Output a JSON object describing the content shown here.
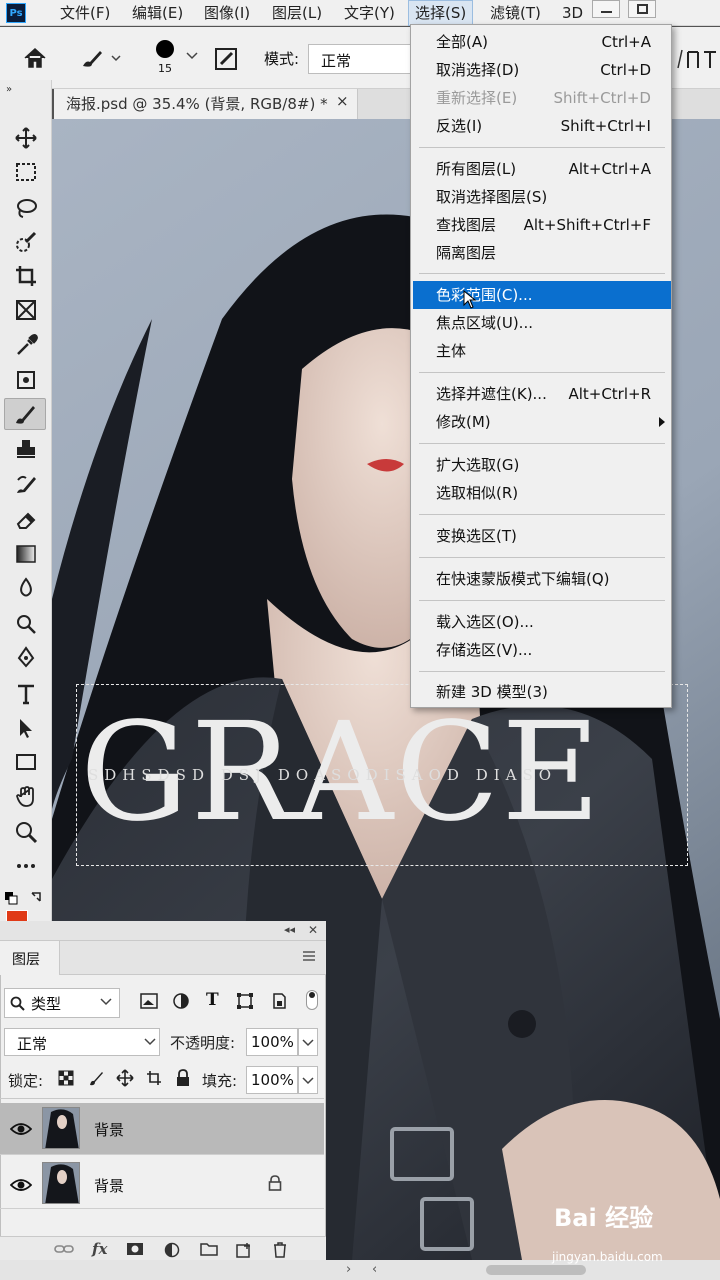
{
  "app": {
    "logo": "Ps"
  },
  "menubar": {
    "items": [
      "文件(F)",
      "编辑(E)",
      "图像(I)",
      "图层(L)",
      "文字(Y)",
      "选择(S)",
      "滤镜(T)",
      "3D"
    ]
  },
  "options": {
    "brush_size": "15",
    "mode_label": "模式:",
    "mode_value": "正常"
  },
  "document": {
    "tab_title": "海报.psd @ 35.4% (背景, RGB/8#) *",
    "close_glyph": "×"
  },
  "canvas": {
    "big_text": "GRACE",
    "small_text": "SDHSDSD DSJ DOASODISAOD DIASO"
  },
  "select_menu": {
    "groups": [
      [
        {
          "label": "全部(A)",
          "shortcut": "Ctrl+A",
          "disabled": false
        },
        {
          "label": "取消选择(D)",
          "shortcut": "Ctrl+D",
          "disabled": false
        },
        {
          "label": "重新选择(E)",
          "shortcut": "Shift+Ctrl+D",
          "disabled": true
        },
        {
          "label": "反选(I)",
          "shortcut": "Shift+Ctrl+I",
          "disabled": false
        }
      ],
      [
        {
          "label": "所有图层(L)",
          "shortcut": "Alt+Ctrl+A",
          "disabled": false
        },
        {
          "label": "取消选择图层(S)",
          "shortcut": "",
          "disabled": false
        },
        {
          "label": "查找图层",
          "shortcut": "Alt+Shift+Ctrl+F",
          "disabled": false
        },
        {
          "label": "隔离图层",
          "shortcut": "",
          "disabled": false
        }
      ],
      [
        {
          "label": "色彩范围(C)...",
          "shortcut": "",
          "disabled": false,
          "highlighted": true
        },
        {
          "label": "焦点区域(U)...",
          "shortcut": "",
          "disabled": false
        },
        {
          "label": "主体",
          "shortcut": "",
          "disabled": false
        }
      ],
      [
        {
          "label": "选择并遮住(K)...",
          "shortcut": "Alt+Ctrl+R",
          "disabled": false
        },
        {
          "label": "修改(M)",
          "shortcut": "",
          "disabled": false,
          "submenu": true
        }
      ],
      [
        {
          "label": "扩大选取(G)",
          "shortcut": "",
          "disabled": false
        },
        {
          "label": "选取相似(R)",
          "shortcut": "",
          "disabled": false
        }
      ],
      [
        {
          "label": "变换选区(T)",
          "shortcut": "",
          "disabled": false
        }
      ],
      [
        {
          "label": "在快速蒙版模式下编辑(Q)",
          "shortcut": "",
          "disabled": false
        }
      ],
      [
        {
          "label": "载入选区(O)...",
          "shortcut": "",
          "disabled": false
        },
        {
          "label": "存储选区(V)...",
          "shortcut": "",
          "disabled": false
        }
      ],
      [
        {
          "label": "新建 3D 模型(3)",
          "shortcut": "",
          "disabled": false
        }
      ]
    ]
  },
  "layers_panel": {
    "tab": "图层",
    "filter_kind": "类型",
    "blend_mode": "正常",
    "opacity_label": "不透明度:",
    "opacity_value": "100%",
    "lock_label": "锁定:",
    "fill_label": "填充:",
    "fill_value": "100%",
    "layers": [
      {
        "name": "背景",
        "selected": true,
        "locked": false
      },
      {
        "name": "背景",
        "selected": false,
        "locked": true
      }
    ]
  },
  "watermark": {
    "brand": "Bai 经验",
    "url": "jingyan.baidu.com"
  },
  "colors": {
    "accent": "#0a6fcf",
    "foreground": "#e03a17",
    "panel": "#f0f0f0"
  }
}
